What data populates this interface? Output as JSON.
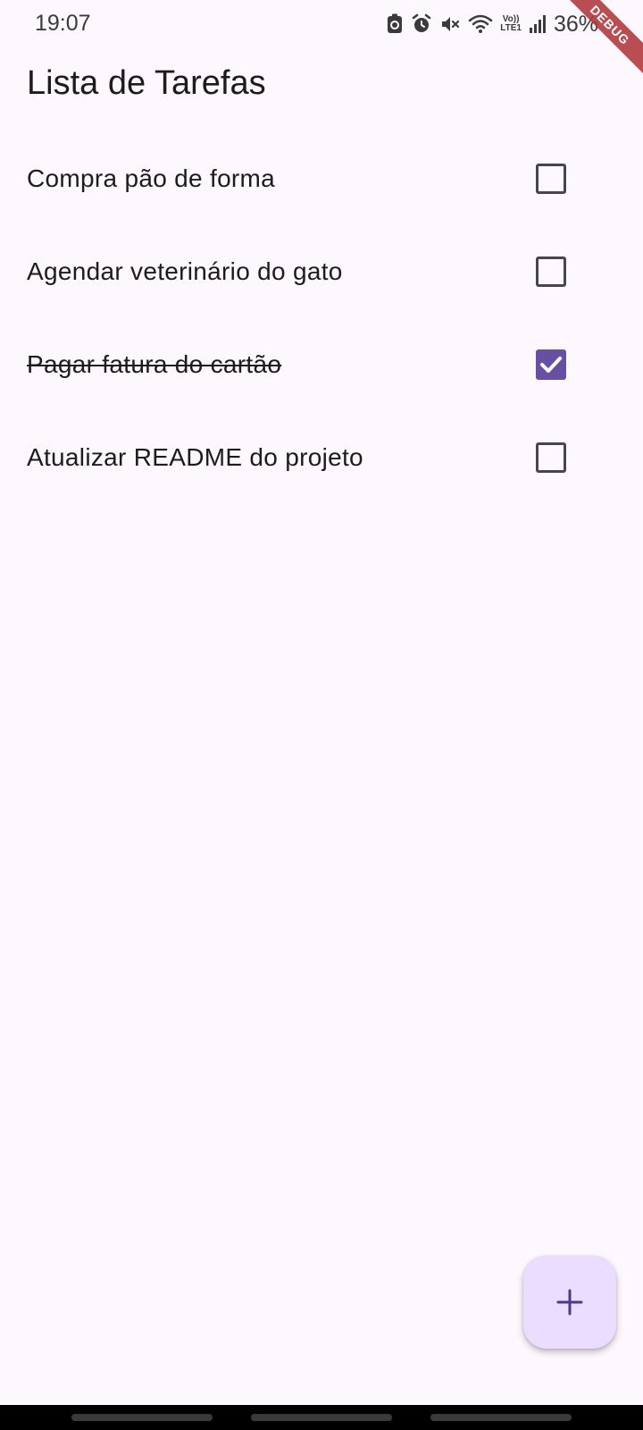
{
  "status_bar": {
    "time": "19:07",
    "network_top": "Vo))",
    "network_bottom": "LTE1",
    "battery": "36%",
    "icons": [
      "app-notification-icon",
      "alarm-icon",
      "mute-icon",
      "wifi-icon",
      "signal-icon"
    ]
  },
  "debug_banner": "DEBUG",
  "app_bar": {
    "title": "Lista de Tarefas"
  },
  "tasks": [
    {
      "label": "Compra pão de forma",
      "done": false
    },
    {
      "label": "Agendar veterinário do gato",
      "done": false
    },
    {
      "label": "Pagar fatura do cartão",
      "done": true
    },
    {
      "label": "Atualizar README do projeto",
      "done": false
    }
  ],
  "fab": {
    "icon": "plus-icon"
  },
  "colors": {
    "background": "#fdf7fe",
    "primary": "#6750a4",
    "fab_background": "#eaddff",
    "debug_banner": "#b0363a"
  }
}
